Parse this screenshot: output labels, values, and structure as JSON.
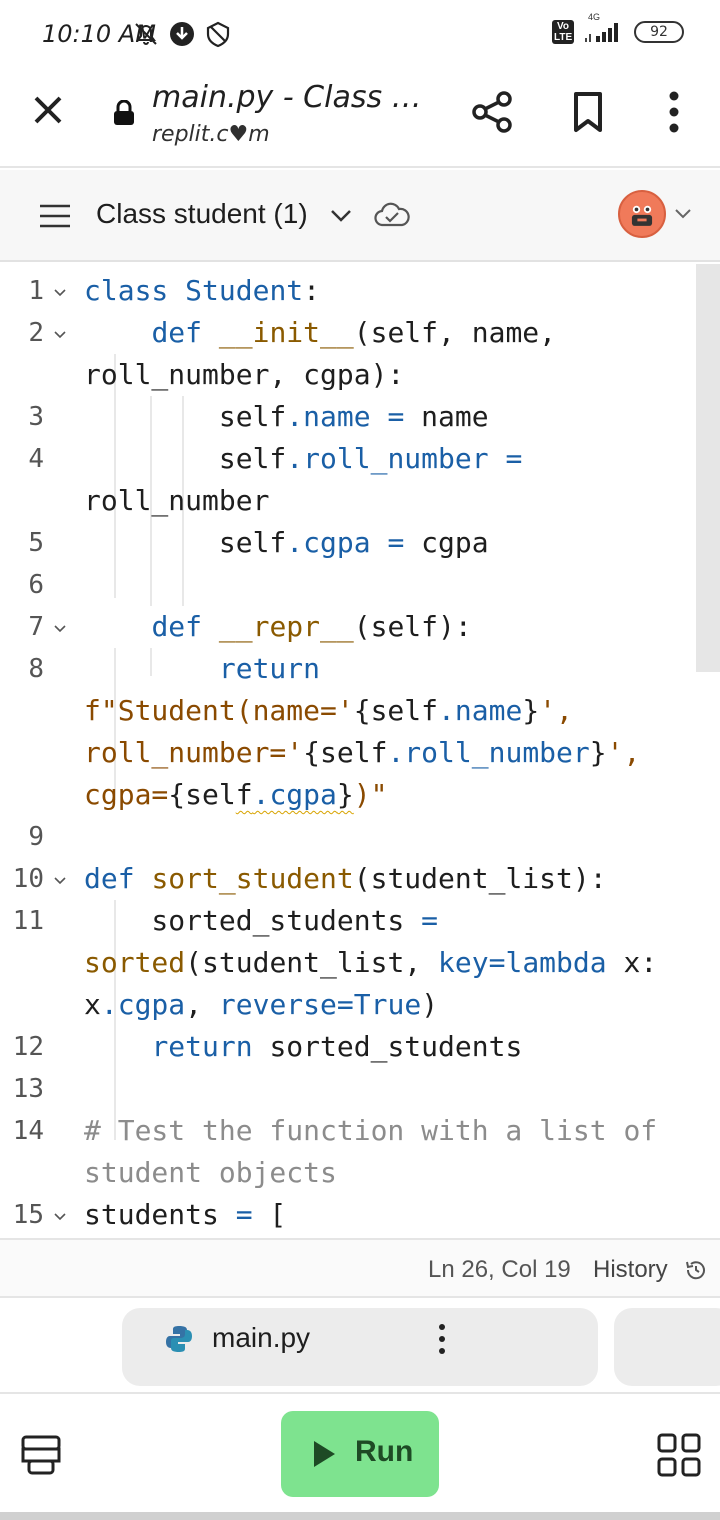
{
  "status_bar": {
    "time": "10:10 AM",
    "network": "4G",
    "volte": "Vo LTE",
    "battery": "92"
  },
  "browser": {
    "page_title": "main.py - Class st...",
    "host": "replit.c♥m"
  },
  "repl": {
    "title": "Class student (1)"
  },
  "editor": {
    "cursor": "Ln 26, Col 19",
    "history_label": "History"
  },
  "files": {
    "active_tab": "main.py"
  },
  "toolbar": {
    "run_label": "Run"
  },
  "code_lines": [
    {
      "num": "1",
      "foldable": true
    },
    {
      "num": "2",
      "foldable": true
    },
    {
      "num": "",
      "foldable": false
    },
    {
      "num": "3",
      "foldable": false
    },
    {
      "num": "4",
      "foldable": false
    },
    {
      "num": "",
      "foldable": false
    },
    {
      "num": "5",
      "foldable": false
    },
    {
      "num": "6",
      "foldable": false
    },
    {
      "num": "7",
      "foldable": true
    },
    {
      "num": "8",
      "foldable": false
    },
    {
      "num": "",
      "foldable": false
    },
    {
      "num": "",
      "foldable": false
    },
    {
      "num": "",
      "foldable": false
    },
    {
      "num": "9",
      "foldable": false
    },
    {
      "num": "10",
      "foldable": true
    },
    {
      "num": "11",
      "foldable": false
    },
    {
      "num": "",
      "foldable": false
    },
    {
      "num": "",
      "foldable": false
    },
    {
      "num": "12",
      "foldable": false
    },
    {
      "num": "13",
      "foldable": false
    },
    {
      "num": "14",
      "foldable": false
    },
    {
      "num": "",
      "foldable": false
    },
    {
      "num": "15",
      "foldable": true
    }
  ],
  "code_tokens": {
    "l1": [
      "class",
      " Student",
      ":"
    ],
    "l2": [
      "    ",
      "def",
      " ",
      "__init__",
      "(self, name,"
    ],
    "l2b": [
      "roll_number, cgpa):"
    ],
    "l3": [
      "        self",
      ".name",
      " ",
      "=",
      " name"
    ],
    "l4": [
      "        self",
      ".roll_number",
      " ",
      "="
    ],
    "l4b": [
      "roll_number"
    ],
    "l5": [
      "        self",
      ".cgpa",
      " ",
      "=",
      " cgpa"
    ],
    "l7": [
      "    ",
      "def",
      " ",
      "__repr__",
      "(self):"
    ],
    "l8": [
      "        ",
      "return"
    ],
    "l8b": [
      "f\"Student(name='",
      "{self",
      ".name",
      "}",
      "',"
    ],
    "l8c": [
      "roll_number='",
      "{self",
      ".roll_number",
      "}",
      "',"
    ],
    "l8d": [
      "cgpa=",
      "{sel",
      "f",
      ".cgpa",
      "}",
      ")\""
    ],
    "l10": [
      "def",
      " ",
      "sort_student",
      "(student_list):"
    ],
    "l11": [
      "    sorted_students ",
      "="
    ],
    "l11b": [
      "sorted",
      "(student_list, ",
      "key",
      "=",
      "lambda",
      " x:"
    ],
    "l11c": [
      "x",
      ".cgpa",
      ", ",
      "reverse",
      "=",
      "True",
      ")"
    ],
    "l12": [
      "    ",
      "return",
      " sorted_students"
    ],
    "l14": [
      "# Test the function with a list of"
    ],
    "l14b": [
      "student objects"
    ],
    "l15": [
      "students ",
      "=",
      " ["
    ]
  },
  "colors": {
    "keyword": "#1a5fa6",
    "function": "#8a5a00",
    "string": "#8a4a00",
    "comment": "#8c8c8c",
    "run_button": "#7ee38f",
    "avatar": "#f07a5a"
  }
}
